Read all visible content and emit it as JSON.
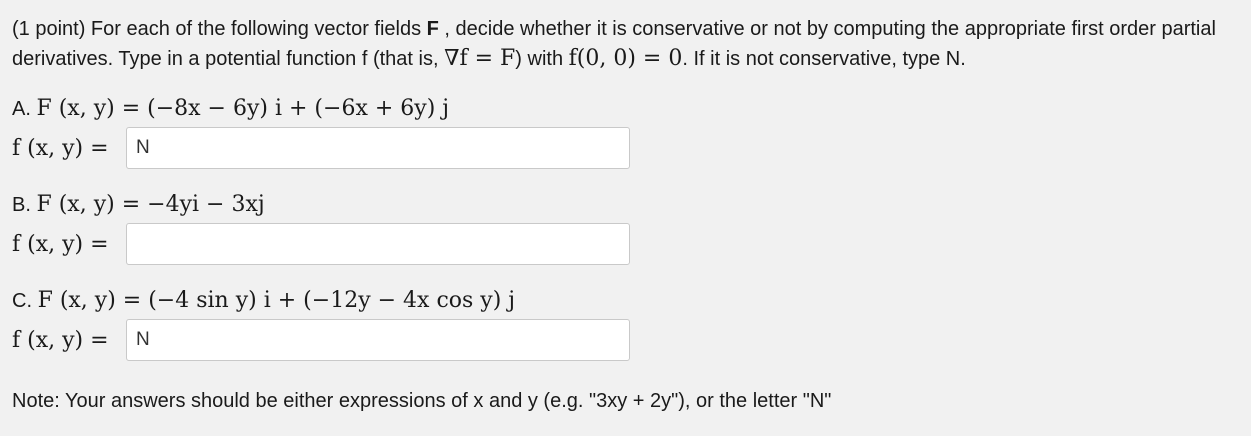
{
  "intro": {
    "points": "(1 point)",
    "text_1": " For each of the following vector fields ",
    "field_symbol": "F",
    "text_2": " , decide whether it is conservative or not by computing the appropriate first order partial derivatives. Type in a potential function f (that is, ",
    "grad_eq": "∇f = F",
    "text_3": ") with ",
    "cond_eq": "f(0, 0) = 0",
    "text_4": ". If it is not conservative, type N."
  },
  "parts": [
    {
      "letter": "A.",
      "field_expr": "F (x, y) = (−8x − 6y) i + (−6x + 6y) j",
      "f_label": "f (x, y) =",
      "answer_value": "N"
    },
    {
      "letter": "B.",
      "field_expr": "F (x, y) = −4yi − 3xj",
      "f_label": "f (x, y) =",
      "answer_value": ""
    },
    {
      "letter": "C.",
      "field_expr": "F (x, y) = (−4 sin y) i + (−12y − 4x cos y) j",
      "f_label": "f (x, y) =",
      "answer_value": "N"
    }
  ],
  "note": "Note: Your answers should be either expressions of x and y (e.g. \"3xy + 2y\"), or the letter \"N\""
}
